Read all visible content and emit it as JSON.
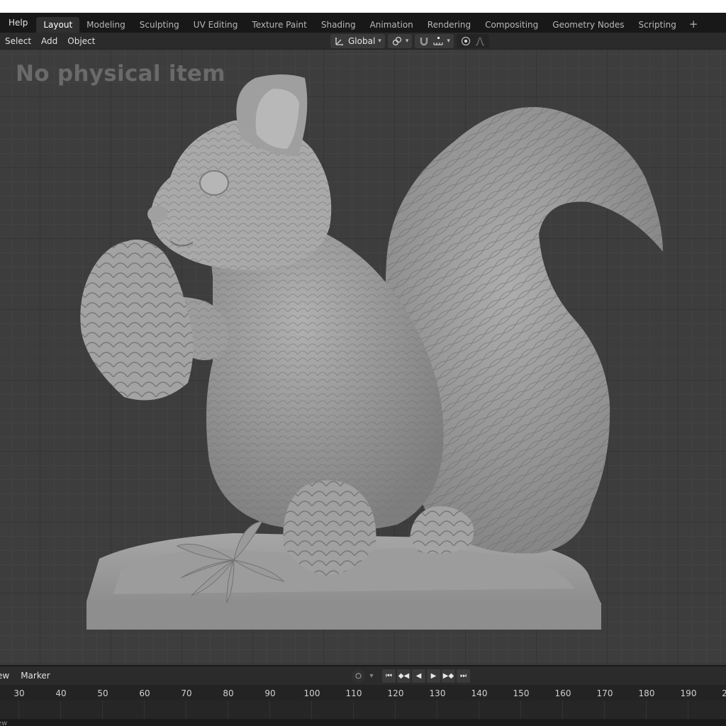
{
  "topbar": {
    "help_label": "Help",
    "tabs": [
      {
        "label": "Layout",
        "active": true
      },
      {
        "label": "Modeling"
      },
      {
        "label": "Sculpting"
      },
      {
        "label": "UV Editing"
      },
      {
        "label": "Texture Paint"
      },
      {
        "label": "Shading"
      },
      {
        "label": "Animation"
      },
      {
        "label": "Rendering"
      },
      {
        "label": "Compositing"
      },
      {
        "label": "Geometry Nodes"
      },
      {
        "label": "Scripting"
      }
    ],
    "add_label": "+"
  },
  "header": {
    "menu": [
      "Select",
      "Add",
      "Object"
    ],
    "orientation_label": "Global"
  },
  "viewport": {
    "watermark": "No physical item"
  },
  "timeline": {
    "menu_view_partial": "ew",
    "menu_marker": "Marker",
    "ticks": [
      "30",
      "40",
      "50",
      "60",
      "70",
      "80",
      "90",
      "100",
      "110",
      "120",
      "130",
      "140",
      "150",
      "160",
      "170",
      "180",
      "190",
      "2"
    ],
    "status_partial": "ew"
  },
  "colors": {
    "tab_active_bg": "#303030",
    "topbar_bg": "#181818",
    "header_bg": "#2b2b2b",
    "viewport_bg": "#3d3d3d",
    "model_gray": "#9a9a9a"
  }
}
